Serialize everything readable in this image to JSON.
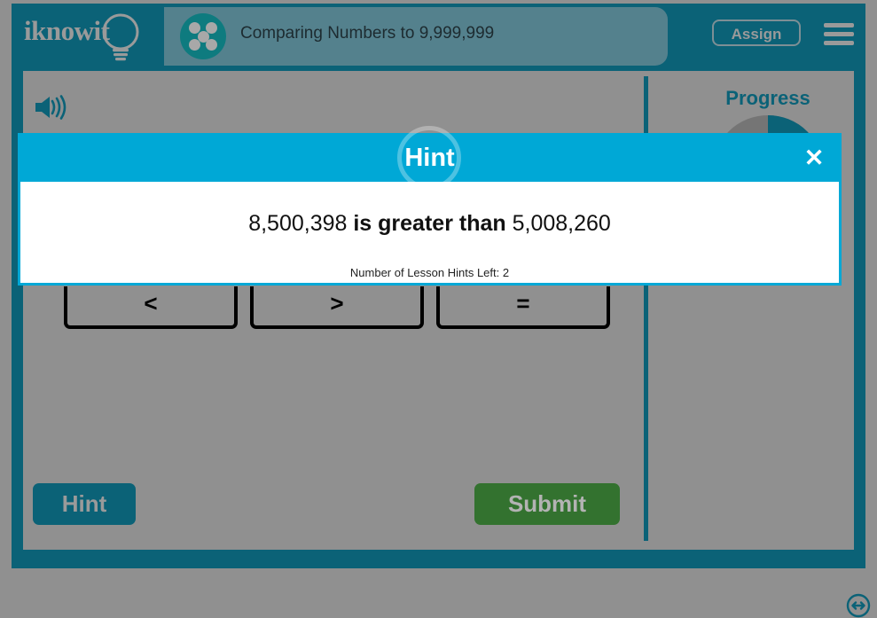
{
  "header": {
    "logo_text": "iknowit",
    "logo_icon": "lightbulb-icon",
    "lesson_icon": "five-dot-dice-icon",
    "lesson_title": "Comparing Numbers to 9,999,999",
    "assign_label": "Assign",
    "menu_icon": "hamburger-menu-icon",
    "colors": {
      "frame_teal": "#0b6277",
      "title_block": "#54818d",
      "lesson_icon_teal": "#0e7b7f",
      "text_grey": "#9a9a9a"
    }
  },
  "content": {
    "speaker_icon": "speaker-audio-icon",
    "compare_buttons": [
      {
        "label": "<",
        "name": "less-than"
      },
      {
        "label": ">",
        "name": "greater-than"
      },
      {
        "label": "=",
        "name": "equal-to"
      }
    ],
    "hint_label": "Hint",
    "submit_label": "Submit",
    "resize_icon": "resize-horizontal-icon",
    "colors": {
      "panel_grey": "#909090",
      "hint_button": "#0b6277",
      "submit_button": "#33722f"
    }
  },
  "progress": {
    "title": "Progress",
    "percent": 25,
    "ring_fill_color": "#0b6277",
    "ring_track_color": "#757575"
  },
  "hint_modal": {
    "title": "Hint",
    "close_icon": "close-x-icon",
    "statement_left": "8,500,398",
    "statement_middle": "is greater than",
    "statement_right": "5,008,260",
    "hints_left_text": "Number of Lesson Hints Left: 2",
    "colors": {
      "header_cyan": "#00a8d6",
      "body_white": "#ffffff"
    }
  }
}
